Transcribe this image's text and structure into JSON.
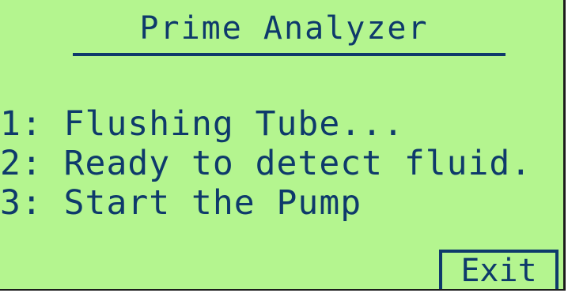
{
  "screen": {
    "title": "Prime Analyzer",
    "steps": [
      {
        "label": "1: Flushing Tube..."
      },
      {
        "label": "2: Ready to detect fluid."
      },
      {
        "label": "3: Start the Pump"
      }
    ],
    "exit_label": "Exit"
  },
  "colors": {
    "background": "#b4f58f",
    "text": "#0e3a6b"
  }
}
